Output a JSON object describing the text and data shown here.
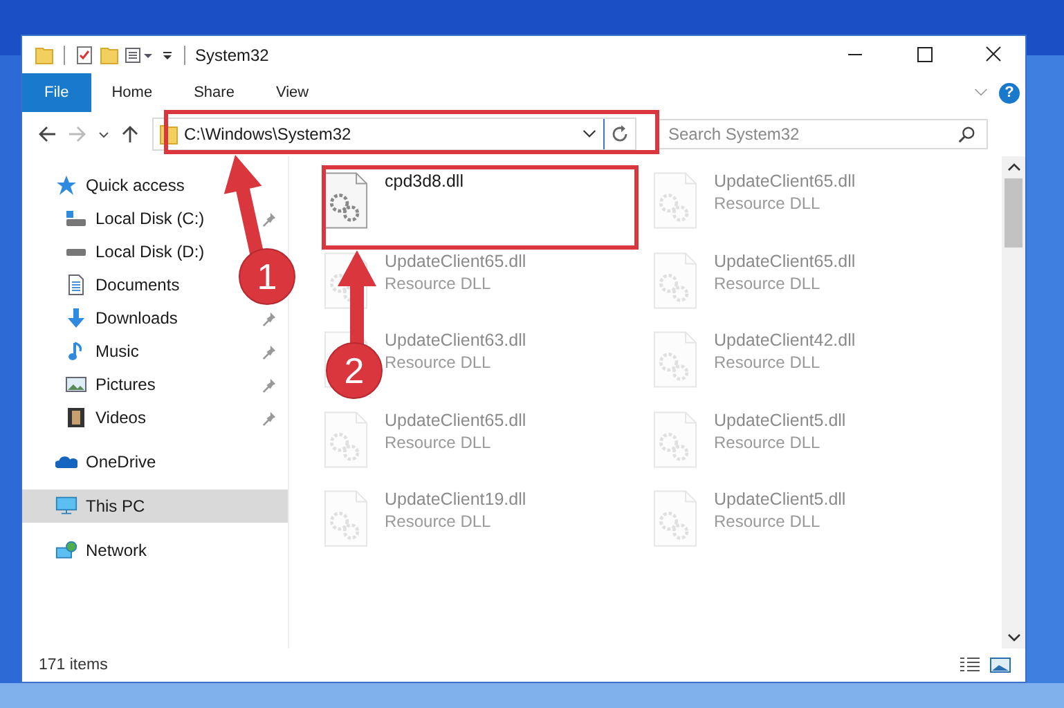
{
  "window": {
    "title": "System32"
  },
  "ribbon": {
    "tabs": [
      {
        "label": "File",
        "selected": true
      },
      {
        "label": "Home",
        "selected": false
      },
      {
        "label": "Share",
        "selected": false
      },
      {
        "label": "View",
        "selected": false
      }
    ],
    "help": "?"
  },
  "address": {
    "path": "C:\\Windows\\System32"
  },
  "search": {
    "placeholder": "Search System32"
  },
  "sidebar": {
    "items": [
      {
        "label": "Quick access",
        "kind": "star",
        "selected": false,
        "children": [
          {
            "label": "Local Disk (C:)",
            "kind": "drive-c",
            "pinned": true
          },
          {
            "label": "Local Disk (D:)",
            "kind": "drive",
            "pinned": false
          },
          {
            "label": "Documents",
            "kind": "documents",
            "pinned": false
          },
          {
            "label": "Downloads",
            "kind": "downloads",
            "pinned": true
          },
          {
            "label": "Music",
            "kind": "music",
            "pinned": true
          },
          {
            "label": "Pictures",
            "kind": "pictures",
            "pinned": true
          },
          {
            "label": "Videos",
            "kind": "videos",
            "pinned": true
          }
        ]
      },
      {
        "label": "OneDrive",
        "kind": "cloud",
        "selected": false
      },
      {
        "label": "This PC",
        "kind": "pc",
        "selected": true
      },
      {
        "label": "Network",
        "kind": "network",
        "selected": false
      }
    ]
  },
  "files": [
    {
      "name": "cpd3d8.dll",
      "faded": false
    },
    {
      "name": "UpdateClient65.dll",
      "type": "Resource DLL",
      "faded": true
    },
    {
      "name": "UpdateClient65.dll",
      "type": "Resource DLL",
      "faded": true
    },
    {
      "name": "UpdateClient65.dll",
      "type": "Resource DLL",
      "faded": true
    },
    {
      "name": "UpdateClient63.dll",
      "type": "Resource DLL",
      "faded": true
    },
    {
      "name": "UpdateClient42.dll",
      "type": "Resource DLL",
      "faded": true
    },
    {
      "name": "UpdateClient65.dll",
      "type": "Resource DLL",
      "faded": true
    },
    {
      "name": "UpdateClient5.dll",
      "type": "Resource DLL",
      "faded": true
    },
    {
      "name": "UpdateClient19.dll",
      "type": "Resource DLL",
      "faded": true
    },
    {
      "name": "UpdateClient5.dll",
      "type": "Resource DLL",
      "faded": true
    }
  ],
  "status_bar": {
    "count": "171 items"
  },
  "annotations": [
    {
      "label": "1"
    },
    {
      "label": "2"
    }
  ]
}
